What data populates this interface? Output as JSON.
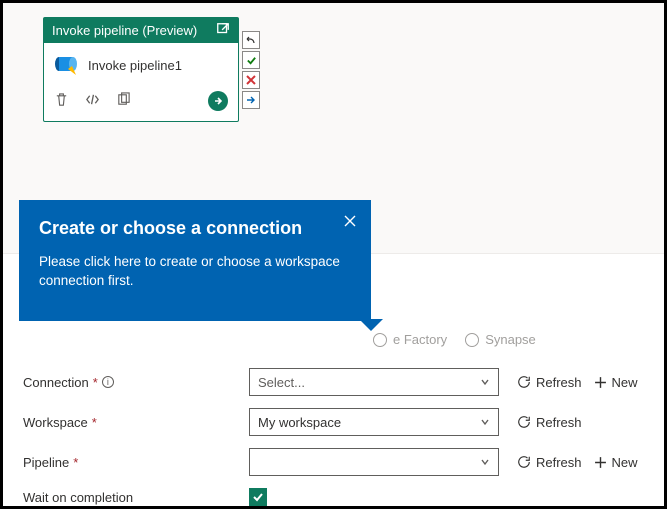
{
  "activity": {
    "title": "Invoke pipeline (Preview)",
    "name": "Invoke pipeline1"
  },
  "callout": {
    "title": "Create or choose a connection",
    "body": "Please click here to create or choose a workspace connection first."
  },
  "radios": {
    "factory": "e Factory",
    "synapse": "Synapse"
  },
  "form": {
    "connection": {
      "label": "Connection",
      "value": "Select..."
    },
    "workspace": {
      "label": "Workspace",
      "value": "My workspace"
    },
    "pipeline": {
      "label": "Pipeline",
      "value": ""
    },
    "wait": {
      "label": "Wait on completion"
    }
  },
  "actions": {
    "refresh": "Refresh",
    "new": "New"
  }
}
